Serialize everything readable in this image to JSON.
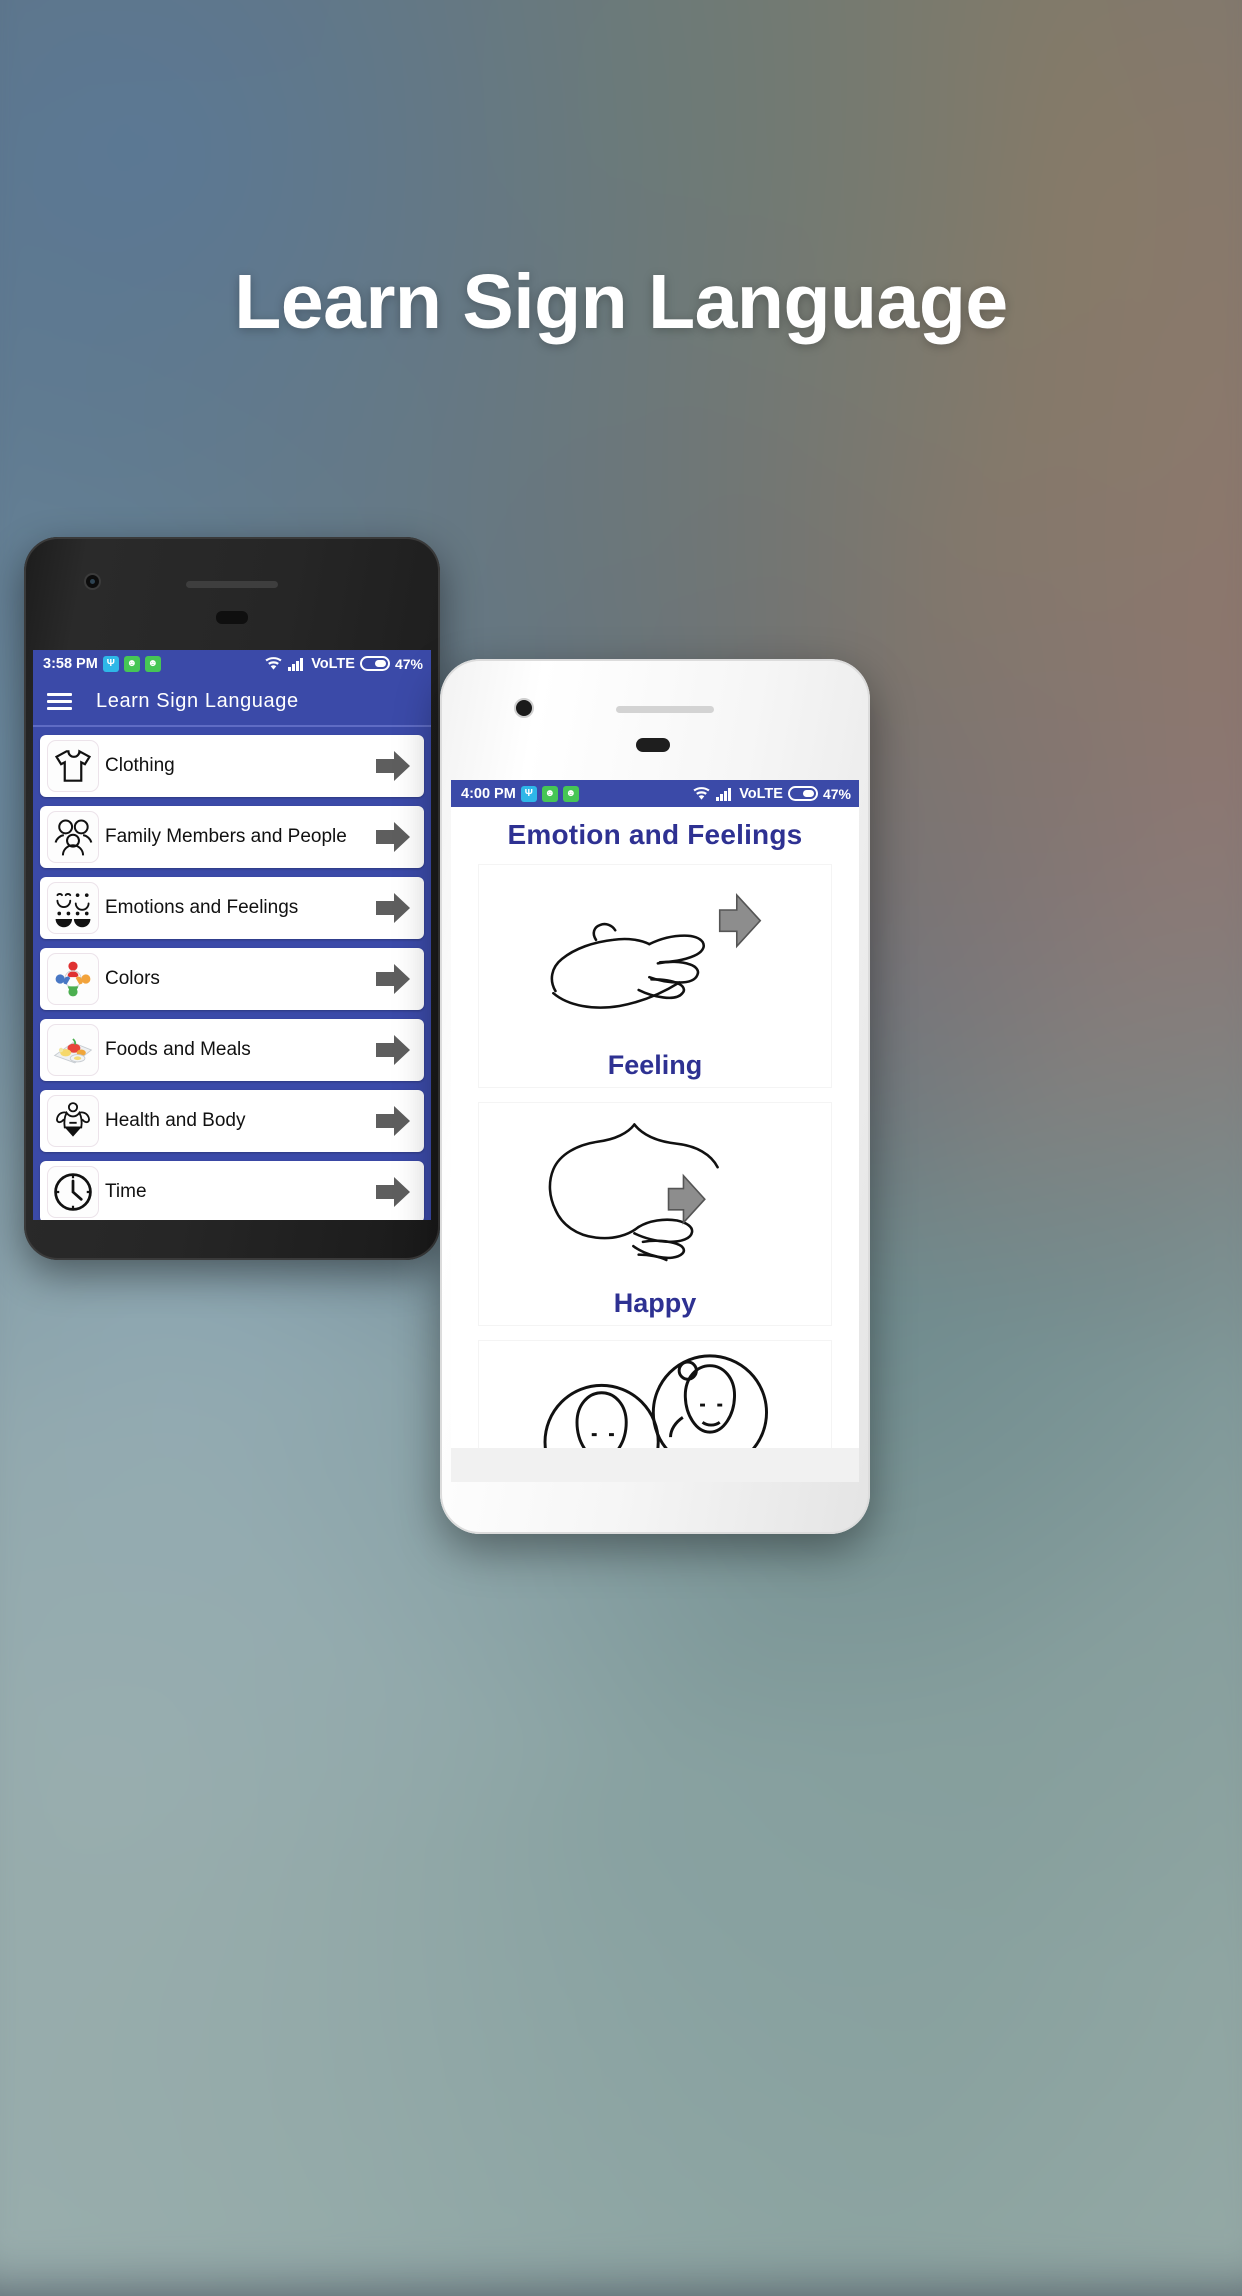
{
  "hero": {
    "title": "Learn Sign Language",
    "title_color": "#ffffff"
  },
  "theme": {
    "primary_blue": "#3b4aa8",
    "header_blue": "#2e3192",
    "arrow_grey": "#5e5e5e"
  },
  "phone_dark": {
    "status_bar": {
      "time": "3:58 PM",
      "icons": [
        "usb-icon",
        "android-bot-icon",
        "android-bot-icon"
      ],
      "wifi": "wifi-icon",
      "signal": "signal-bars-icon",
      "network": "VoLTE",
      "battery": "battery-icon",
      "battery_percent": "47%"
    },
    "toolbar": {
      "menu_icon": "hamburger-menu-icon",
      "title": "Learn Sign Language"
    },
    "list": [
      {
        "label": "Clothing",
        "icon": "tshirt-icon",
        "chevron": "arrow-right-icon"
      },
      {
        "label": "Family Members and People",
        "icon": "family-people-icon",
        "chevron": "arrow-right-icon"
      },
      {
        "label": "Emotions and Feelings",
        "icon": "smiley-faces-icon",
        "chevron": "arrow-right-icon"
      },
      {
        "label": "Colors",
        "icon": "color-wheel-people-icon",
        "chevron": "arrow-right-icon"
      },
      {
        "label": "Foods and Meals",
        "icon": "food-plate-icon",
        "chevron": "arrow-right-icon"
      },
      {
        "label": "Health and Body",
        "icon": "muscle-body-icon",
        "chevron": "arrow-right-icon"
      },
      {
        "label": "Time",
        "icon": "clock-icon",
        "chevron": "arrow-right-icon"
      }
    ]
  },
  "phone_white": {
    "status_bar": {
      "time": "4:00 PM",
      "icons": [
        "usb-icon",
        "android-bot-icon",
        "android-bot-icon"
      ],
      "wifi": "wifi-icon",
      "signal": "signal-bars-icon",
      "network": "VoLTE",
      "battery": "battery-icon",
      "battery_percent": "47%"
    },
    "page_title": "Emotion and Feelings",
    "signs": [
      {
        "label": "Feeling",
        "art": "hand-feeling-sign-illustration"
      },
      {
        "label": "Happy",
        "art": "torso-happy-sign-illustration"
      },
      {
        "label": "",
        "art": "two-faces-sign-illustration"
      }
    ]
  }
}
